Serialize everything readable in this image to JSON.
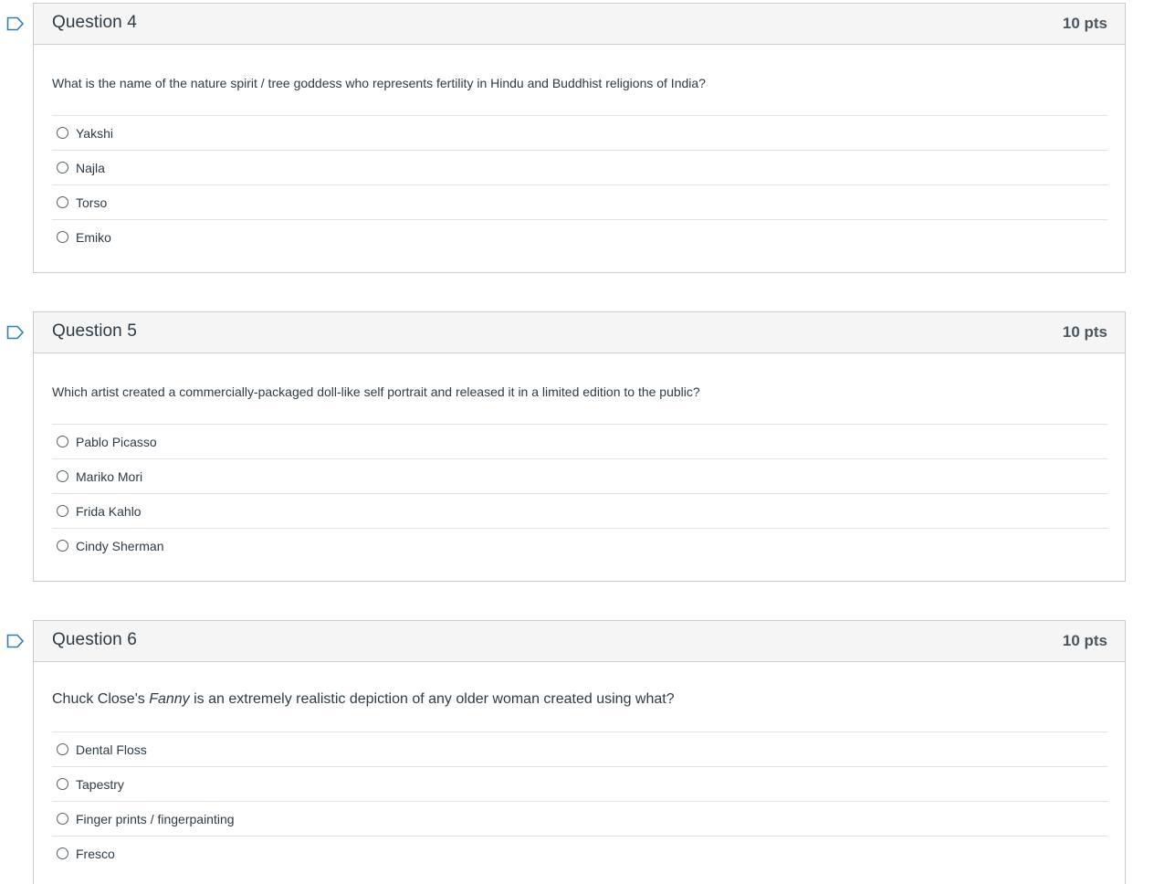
{
  "colors": {
    "flag": "#2d7fb5",
    "header_bg": "#f5f5f5",
    "border": "#c7cdd1",
    "text": "#2d3b45"
  },
  "questions": [
    {
      "title": "Question 4",
      "points": "10 pts",
      "text": "What is the name of the nature spirit / tree goddess who represents fertility in Hindu and Buddhist religions of India?",
      "answers": [
        "Yakshi",
        "Najla",
        "Torso",
        "Emiko"
      ]
    },
    {
      "title": "Question 5",
      "points": "10 pts",
      "text": "Which artist created a commercially-packaged doll-like self portrait and released it in a limited edition to the public?",
      "answers": [
        "Pablo Picasso",
        "Mariko Mori",
        "Frida Kahlo",
        "Cindy Sherman"
      ]
    },
    {
      "title": "Question 6",
      "points": "10 pts",
      "text_before": "Chuck Close's ",
      "text_italic": "Fanny",
      "text_after": " is an extremely realistic depiction of any older woman created using what?",
      "answers": [
        "Dental Floss",
        "Tapestry",
        "Finger prints / fingerpainting",
        "Fresco"
      ]
    }
  ]
}
